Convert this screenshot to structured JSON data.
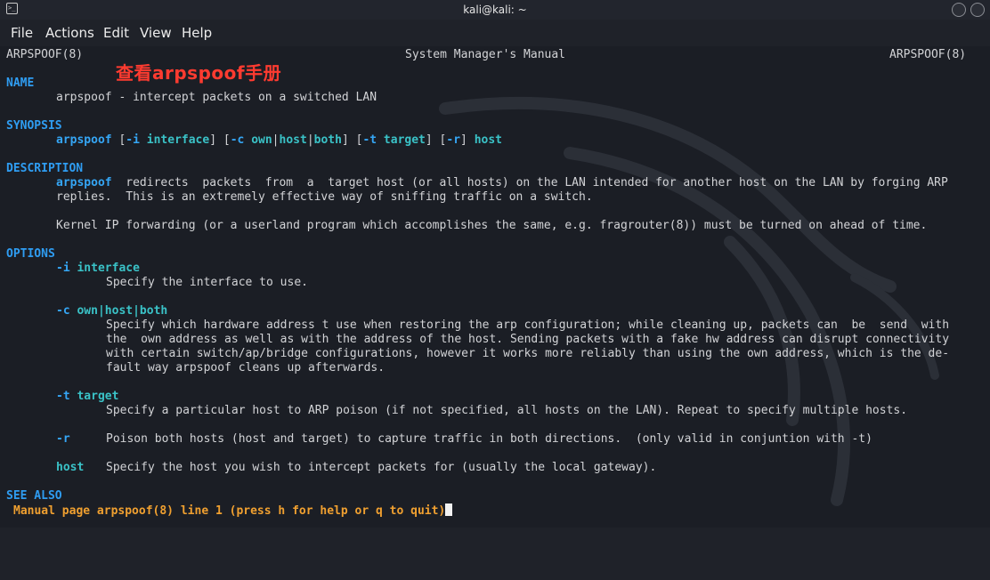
{
  "window": {
    "title": "kali@kali: ~"
  },
  "menu": [
    "File",
    "Actions",
    "Edit",
    "View",
    "Help"
  ],
  "header": {
    "left": "ARPSPOOF(8)",
    "center": "System Manager's Manual",
    "right": "ARPSPOOF(8)"
  },
  "annotation": "查看arpspoof手册",
  "name": {
    "heading": "NAME",
    "text": "arpspoof - intercept packets on a switched LAN"
  },
  "synopsis": {
    "heading": "SYNOPSIS",
    "cmd": "arpspoof",
    "parts": [
      "[-i interface]",
      "[-c own|host|both]",
      "[-t target]",
      "[-r]",
      "host"
    ]
  },
  "description": {
    "heading": "DESCRIPTION",
    "cmd": "arpspoof",
    "line1_rest": "  redirects  packets  from  a  target host (or all hosts) on the LAN intended for another host on the LAN by forging ARP",
    "line2": "replies.  This is an extremely effective way of sniffing traffic on a switch.",
    "line3": "Kernel IP forwarding (or a userland program which accomplishes the same, e.g. fragrouter(8)) must be turned on ahead of time."
  },
  "options": {
    "heading": "OPTIONS",
    "i": {
      "flag": "-i",
      "arg": "interface",
      "desc": "Specify the interface to use."
    },
    "c": {
      "flag": "-c",
      "arg": "own|host|both",
      "desc": [
        "Specify which hardware address t use when restoring the arp configuration; while cleaning up, packets can  be  send  with",
        "the  own address as well as with the address of the host. Sending packets with a fake hw address can disrupt connectivity",
        "with certain switch/ap/bridge configurations, however it works more reliably than using the own address, which is the de-",
        "fault way arpspoof cleans up afterwards."
      ]
    },
    "t": {
      "flag": "-t",
      "arg": "target",
      "desc": "Specify a particular host to ARP poison (if not specified, all hosts on the LAN). Repeat to specify multiple hosts."
    },
    "r": {
      "flag": "-r",
      "desc": "Poison both hosts (host and target) to capture traffic in both directions.  (only valid in conjuntion with -t)"
    },
    "host": {
      "flag": "host",
      "desc": "Specify the host you wish to intercept packets for (usually the local gateway)."
    }
  },
  "see_also": {
    "heading": "SEE ALSO"
  },
  "status": "Manual page arpspoof(8) line 1 (press h for help or q to quit)"
}
